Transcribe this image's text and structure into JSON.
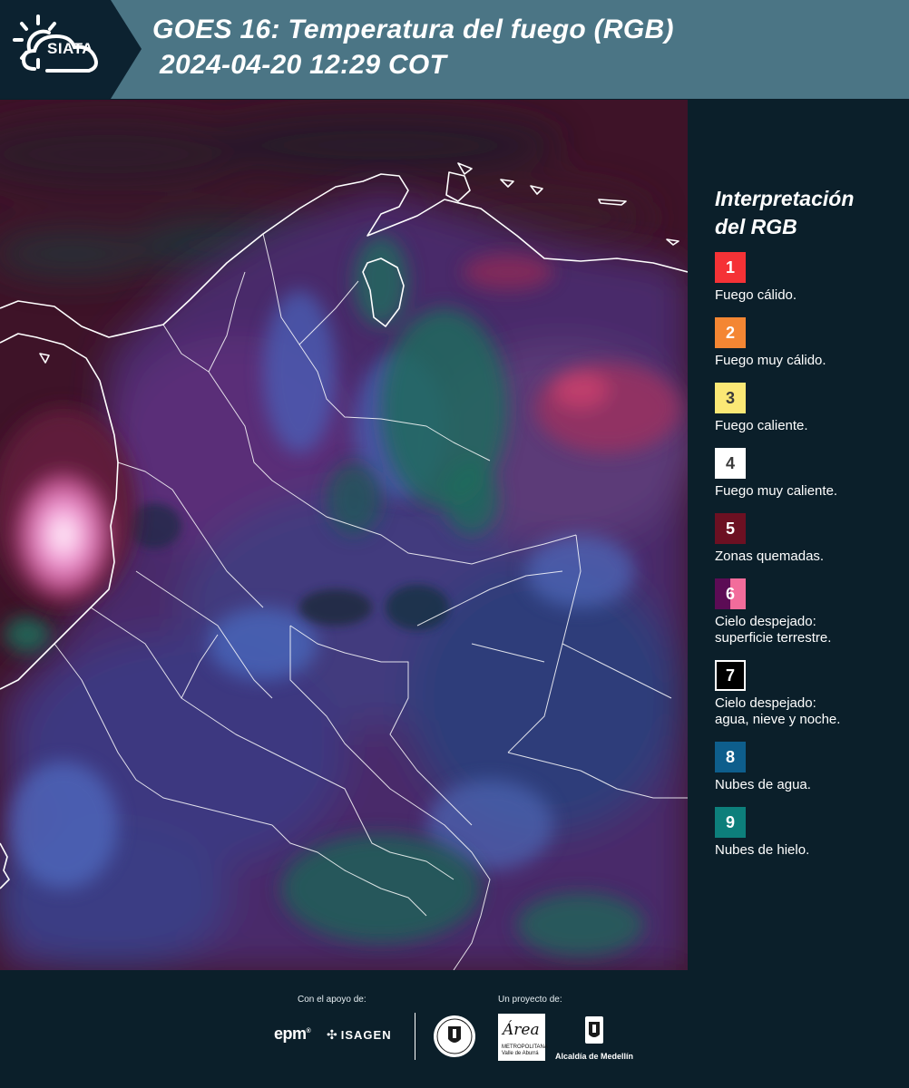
{
  "header": {
    "brand": "SIATA",
    "title_line1": "GOES 16: Temperatura del fuego (RGB)",
    "title_line2": "2024-04-20 12:29 COT"
  },
  "legend": {
    "title_line1": "Interpretación",
    "title_line2": "del RGB",
    "items": [
      {
        "number": "1",
        "label": "Fuego cálido.",
        "color": "#f53236",
        "text_color": "#ffffff"
      },
      {
        "number": "2",
        "label": "Fuego muy cálido.",
        "color": "#f48633",
        "text_color": "#ffffff"
      },
      {
        "number": "3",
        "label": "Fuego caliente.",
        "color": "#fbe875",
        "text_color": "#3a3a3a"
      },
      {
        "number": "4",
        "label": "Fuego muy caliente.",
        "color": "#ffffff",
        "text_color": "#3a3a3a"
      },
      {
        "number": "5",
        "label": "Zonas quemadas.",
        "color": "#6c1022",
        "text_color": "#ffffff"
      },
      {
        "number": "6",
        "label_line1": "Cielo despejado:",
        "label_line2": "superficie terrestre.",
        "color_a": "#5c0c55",
        "color_b": "#f26c9b",
        "text_color": "#ffffff"
      },
      {
        "number": "7",
        "label_line1": "Cielo despejado:",
        "label_line2": "agua, nieve y noche.",
        "color": "#000000",
        "border": "#ffffff",
        "text_color": "#ffffff"
      },
      {
        "number": "8",
        "label": "Nubes de agua.",
        "color": "#0e5e8c",
        "text_color": "#ffffff"
      },
      {
        "number": "9",
        "label": "Nubes de hielo.",
        "color": "#0d7f7b",
        "text_color": "#ffffff"
      }
    ]
  },
  "footer": {
    "support_label": "Con el apoyo de:",
    "project_label": "Un proyecto de:",
    "epm": "epm",
    "isagen": "ISAGEN",
    "area_word": "Área",
    "area_sub": "METROPOLITANA Valle de Aburrá",
    "alcaldia": "Alcaldía de Medellín"
  }
}
